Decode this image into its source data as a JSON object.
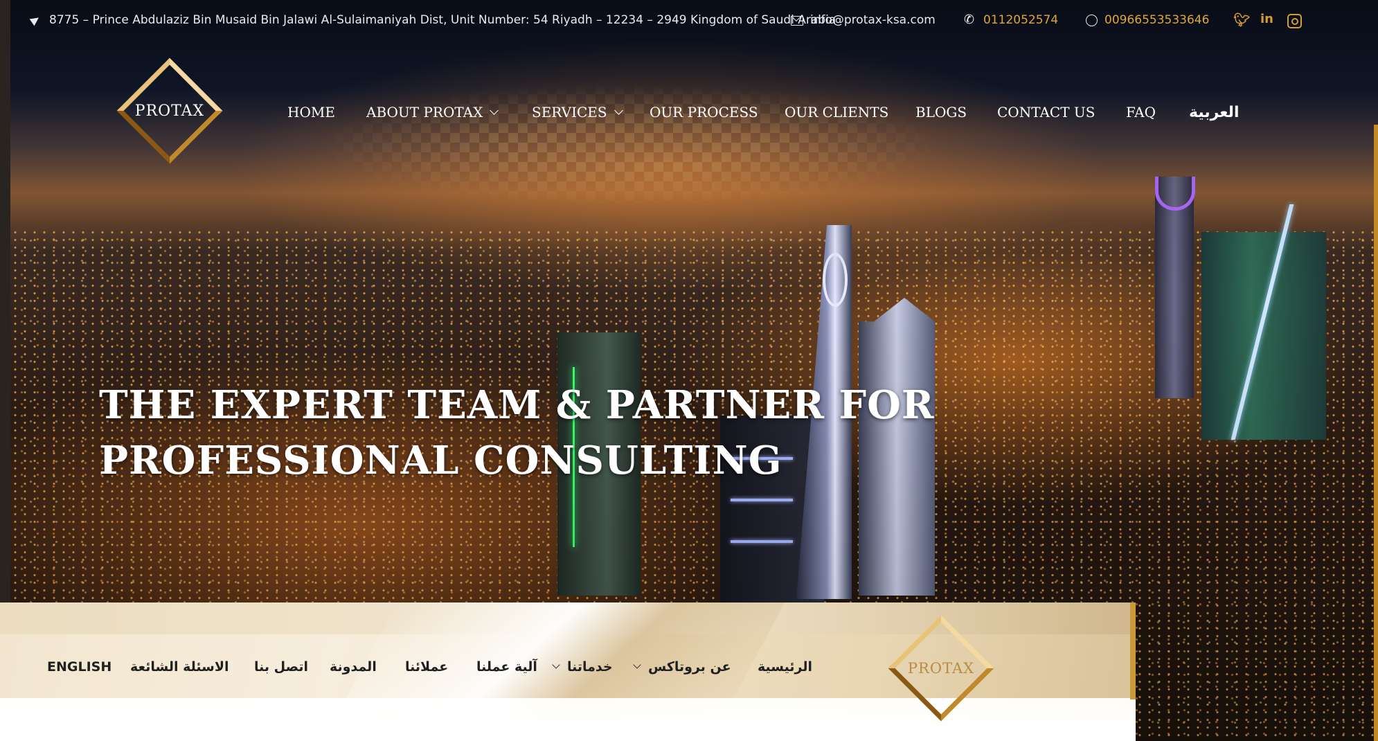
{
  "topbar": {
    "address": "8775 – Prince Abdulaziz Bin Musaid Bin Jalawi Al-Sulaimaniyah Dist, Unit Number: 54 Riyadh – 12234 – 2949 Kingdom of Saudi Arabia",
    "email": "info@protax-ksa.com",
    "phone": "0112052574",
    "whatsapp": "00966553533646",
    "icons": [
      "location-icon",
      "mail-icon",
      "phone-icon",
      "whatsapp-icon"
    ],
    "social": [
      "twitter-icon",
      "linkedin-icon",
      "instagram-icon"
    ],
    "linkedin_glyph": "in"
  },
  "brand": {
    "logo_text": "PROTAX"
  },
  "nav": {
    "home": "HOME",
    "about": "ABOUT PROTAX",
    "services": "SERVICES",
    "process": "OUR PROCESS",
    "clients": "OUR CLIENTS",
    "blogs": "BLOGS",
    "contact": "CONTACT US",
    "faq": "FAQ",
    "arabic": "العربية"
  },
  "hero": {
    "line1": "THE EXPERT TEAM & PARTNER FOR",
    "line2": "PROFESSIONAL CONSULTING"
  },
  "sticky_nav": {
    "home": "الرئيسية",
    "about": "عن بروتاكس",
    "services": "خدماتنا",
    "process": "آلية عملنا",
    "clients": "عملائنا",
    "blog": "المدونة",
    "contact": "اتصل بنا",
    "faq": "الاسئلة الشائعة",
    "english": "ENGLISH"
  },
  "colors": {
    "accent_gold": "#e0a63c",
    "nav_text": "#ffffff",
    "strip_bg": "#f2e6cf"
  }
}
